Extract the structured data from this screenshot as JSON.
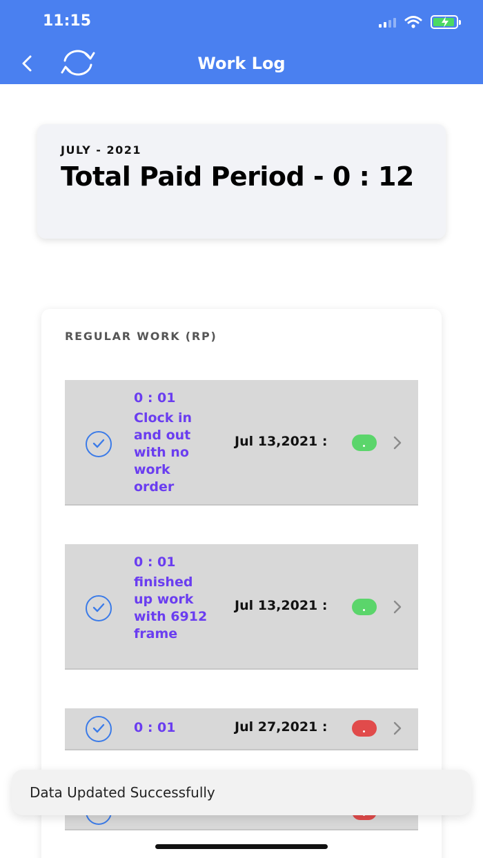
{
  "status_bar": {
    "time": "11:15"
  },
  "nav": {
    "title": "Work Log"
  },
  "summary": {
    "month": "JULY - 2021",
    "total_label": "Total Paid Period - 0 : 12"
  },
  "section": {
    "title": "REGULAR WORK (RP)"
  },
  "entries": [
    {
      "duration": "0 : 01",
      "description": "Clock in and out with no work order",
      "date": "Jul 13,2021 :",
      "status_color": "#5bd56b"
    },
    {
      "duration": "0 : 01",
      "description": "finished up work with 6912 frame",
      "date": "Jul 13,2021 :",
      "status_color": "#5bd56b"
    },
    {
      "duration": "0 : 01",
      "description": "",
      "date": "Jul 27,2021 :",
      "status_color": "#e14b4b"
    }
  ],
  "toast": {
    "message": "Data Updated Successfully"
  },
  "colors": {
    "header": "#4a80f0",
    "accent_text": "#6a3df0",
    "check": "#3b7be8"
  }
}
